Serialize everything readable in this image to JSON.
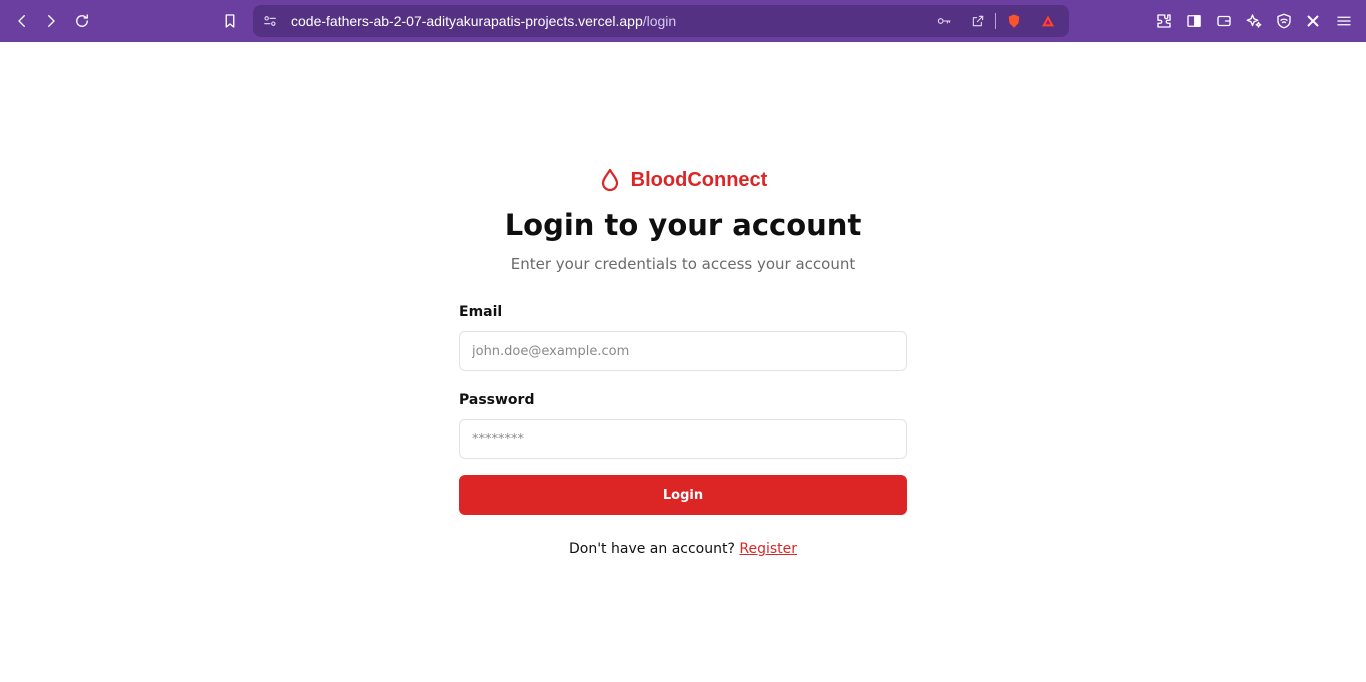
{
  "browser": {
    "url_host": "code-fathers-ab-2-07-adityakurapatis-projects.vercel.app",
    "url_path": "/login",
    "icons": [
      "back-icon",
      "forward-icon",
      "reload-icon",
      "bookmark-icon",
      "site-settings-icon",
      "password-key-icon",
      "share-icon",
      "brave-shields-icon",
      "brave-rewards-icon",
      "extensions-icon",
      "sidebar-icon",
      "wallet-icon",
      "leo-ai-icon",
      "vpn-icon",
      "extension-x-icon",
      "menu-icon"
    ],
    "colors": {
      "toolbar": "#6a3fa0",
      "urlbar": "#553184"
    }
  },
  "brand": {
    "name": "BloodConnect",
    "icon": "blood-drop-icon",
    "color": "#dc2626"
  },
  "login": {
    "title": "Login to your account",
    "subtitle": "Enter your credentials to access your account",
    "email_label": "Email",
    "email_placeholder": "john.doe@example.com",
    "password_label": "Password",
    "password_placeholder": "********",
    "submit_label": "Login",
    "register_prompt": "Don't have an account?",
    "register_link": "Register"
  }
}
